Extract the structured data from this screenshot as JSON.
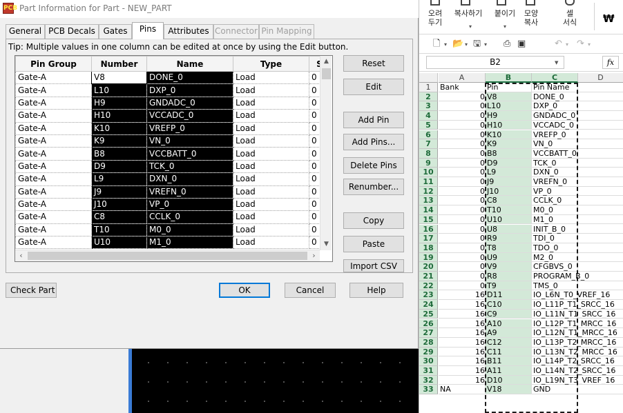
{
  "dialog": {
    "title": "Part Information for Part - NEW_PART",
    "icon_label": "PCB",
    "tabs": [
      "General",
      "PCB Decals",
      "Gates",
      "Pins",
      "Attributes",
      "Connector",
      "Pin Mapping"
    ],
    "active_tab": "Pins",
    "disabled_tabs": [
      "Connector",
      "Pin Mapping"
    ],
    "tip": "Tip: Multiple values in one column can be edited at once by using the Edit button.",
    "columns": [
      "Pin Group",
      "Number",
      "Name",
      "Type",
      "S"
    ],
    "rows": [
      [
        "Gate-A",
        "V8",
        "DONE_0",
        "Load",
        "0"
      ],
      [
        "Gate-A",
        "L10",
        "DXP_0",
        "Load",
        "0"
      ],
      [
        "Gate-A",
        "H9",
        "GNDADC_0",
        "Load",
        "0"
      ],
      [
        "Gate-A",
        "H10",
        "VCCADC_0",
        "Load",
        "0"
      ],
      [
        "Gate-A",
        "K10",
        "VREFP_0",
        "Load",
        "0"
      ],
      [
        "Gate-A",
        "K9",
        "VN_0",
        "Load",
        "0"
      ],
      [
        "Gate-A",
        "B8",
        "VCCBATT_0",
        "Load",
        "0"
      ],
      [
        "Gate-A",
        "D9",
        "TCK_0",
        "Load",
        "0"
      ],
      [
        "Gate-A",
        "L9",
        "DXN_0",
        "Load",
        "0"
      ],
      [
        "Gate-A",
        "J9",
        "VREFN_0",
        "Load",
        "0"
      ],
      [
        "Gate-A",
        "J10",
        "VP_0",
        "Load",
        "0"
      ],
      [
        "Gate-A",
        "C8",
        "CCLK_0",
        "Load",
        "0"
      ],
      [
        "Gate-A",
        "T10",
        "M0_0",
        "Load",
        "0"
      ],
      [
        "Gate-A",
        "U10",
        "M1_0",
        "Load",
        "0"
      ]
    ],
    "buttons": {
      "reset": "Reset",
      "edit": "Edit",
      "add_pin": "Add Pin",
      "add_pins": "Add Pins...",
      "delete_pins": "Delete Pins",
      "renumber": "Renumber...",
      "copy": "Copy",
      "paste": "Paste",
      "import_csv": "Import CSV",
      "check_part": "Check Part",
      "ok": "OK",
      "cancel": "Cancel",
      "help": "Help"
    }
  },
  "excel": {
    "ribbon": {
      "sort": "오려\n두기",
      "copy": "복사하기",
      "paste": "붙이기",
      "format_copy": "모양\n복사",
      "cell_format": "셀\n서식",
      "currency": "₩"
    },
    "name_box": "B2",
    "fx": "fx",
    "columns": [
      "A",
      "B",
      "C",
      "D"
    ],
    "active_column": "B",
    "rows": [
      {
        "n": "1",
        "A": "Bank",
        "B": "Pin",
        "C": "Pin Name",
        "D": ""
      },
      {
        "n": "2",
        "A": "0",
        "B": "V8",
        "C": "DONE_0",
        "D": ""
      },
      {
        "n": "3",
        "A": "0",
        "B": "L10",
        "C": "DXP_0",
        "D": ""
      },
      {
        "n": "4",
        "A": "0",
        "B": "H9",
        "C": "GNDADC_0",
        "D": ""
      },
      {
        "n": "5",
        "A": "0",
        "B": "H10",
        "C": "VCCADC_0",
        "D": ""
      },
      {
        "n": "6",
        "A": "0",
        "B": "K10",
        "C": "VREFP_0",
        "D": ""
      },
      {
        "n": "7",
        "A": "0",
        "B": "K9",
        "C": "VN_0",
        "D": ""
      },
      {
        "n": "8",
        "A": "0",
        "B": "B8",
        "C": "VCCBATT_0",
        "D": ""
      },
      {
        "n": "9",
        "A": "0",
        "B": "D9",
        "C": "TCK_0",
        "D": ""
      },
      {
        "n": "10",
        "A": "0",
        "B": "L9",
        "C": "DXN_0",
        "D": ""
      },
      {
        "n": "11",
        "A": "0",
        "B": "J9",
        "C": "VREFN_0",
        "D": ""
      },
      {
        "n": "12",
        "A": "0",
        "B": "J10",
        "C": "VP_0",
        "D": ""
      },
      {
        "n": "13",
        "A": "0",
        "B": "C8",
        "C": "CCLK_0",
        "D": ""
      },
      {
        "n": "14",
        "A": "0",
        "B": "T10",
        "C": "M0_0",
        "D": ""
      },
      {
        "n": "15",
        "A": "0",
        "B": "U10",
        "C": "M1_0",
        "D": ""
      },
      {
        "n": "16",
        "A": "0",
        "B": "U8",
        "C": "INIT_B_0",
        "D": ""
      },
      {
        "n": "17",
        "A": "0",
        "B": "R9",
        "C": "TDI_0",
        "D": ""
      },
      {
        "n": "18",
        "A": "0",
        "B": "T8",
        "C": "TDO_0",
        "D": ""
      },
      {
        "n": "19",
        "A": "0",
        "B": "U9",
        "C": "M2_0",
        "D": ""
      },
      {
        "n": "20",
        "A": "0",
        "B": "V9",
        "C": "CFGBVS_0",
        "D": ""
      },
      {
        "n": "21",
        "A": "0",
        "B": "R8",
        "C": "PROGRAM_B_0",
        "D": ""
      },
      {
        "n": "22",
        "A": "0",
        "B": "T9",
        "C": "TMS_0",
        "D": ""
      },
      {
        "n": "23",
        "A": "16",
        "B": "D11",
        "C": "IO_L6N_T0_VREF_16",
        "D": ""
      },
      {
        "n": "24",
        "A": "16",
        "B": "C10",
        "C": "IO_L11P_T1_SRCC_16",
        "D": ""
      },
      {
        "n": "25",
        "A": "16",
        "B": "C9",
        "C": "IO_L11N_T1_SRCC_16",
        "D": ""
      },
      {
        "n": "26",
        "A": "16",
        "B": "A10",
        "C": "IO_L12P_T1_MRCC_16",
        "D": ""
      },
      {
        "n": "27",
        "A": "16",
        "B": "A9",
        "C": "IO_L12N_T1_MRCC_16",
        "D": ""
      },
      {
        "n": "28",
        "A": "16",
        "B": "C12",
        "C": "IO_L13P_T2_MRCC_16",
        "D": ""
      },
      {
        "n": "29",
        "A": "16",
        "B": "C11",
        "C": "IO_L13N_T2_MRCC_16",
        "D": ""
      },
      {
        "n": "30",
        "A": "16",
        "B": "B11",
        "C": "IO_L14P_T2_SRCC_16",
        "D": ""
      },
      {
        "n": "31",
        "A": "16",
        "B": "A11",
        "C": "IO_L14N_T2_SRCC_16",
        "D": ""
      },
      {
        "n": "32",
        "A": "16",
        "B": "D10",
        "C": "IO_L19N_T3_VREF_16",
        "D": ""
      },
      {
        "n": "33",
        "A": "NA",
        "B": "V18",
        "C": "GND",
        "D": ""
      }
    ]
  }
}
